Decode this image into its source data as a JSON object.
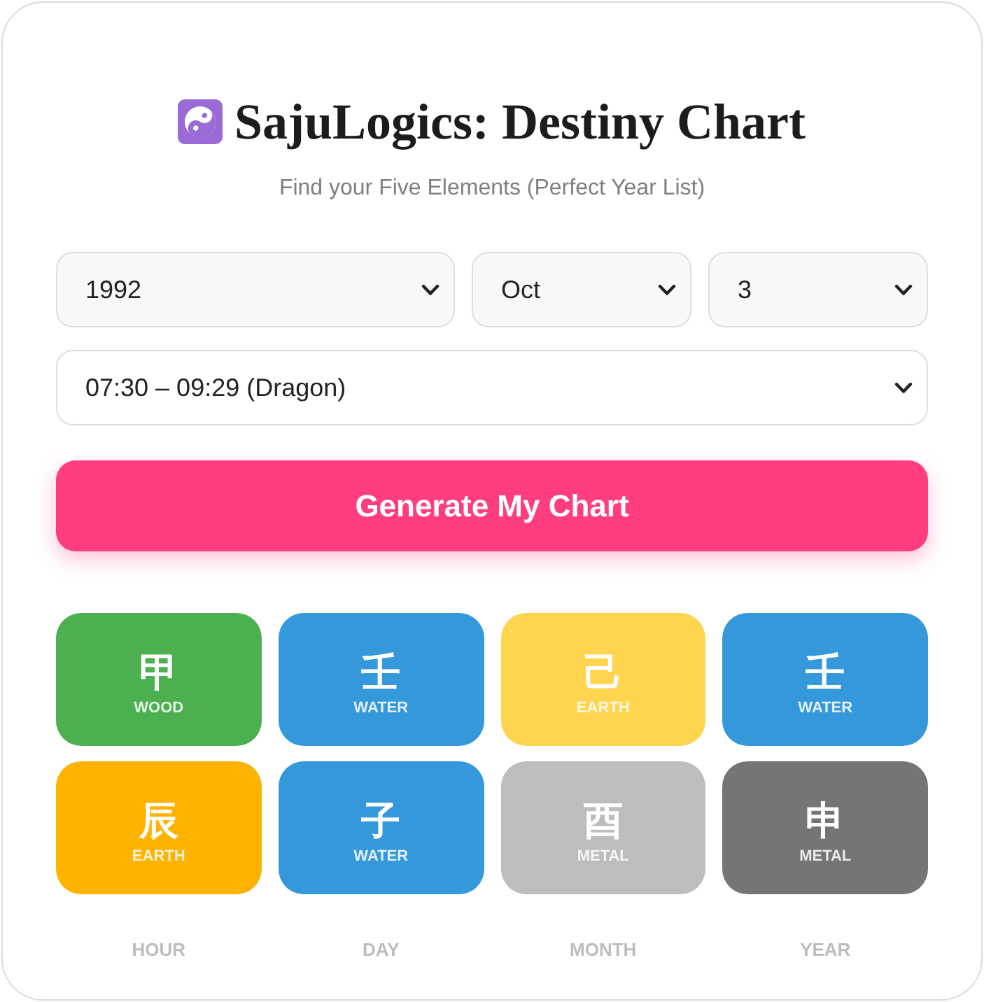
{
  "header": {
    "title": "SajuLogics: Destiny Chart",
    "subtitle": "Find your Five Elements (Perfect Year List)"
  },
  "date_fields": [
    {
      "kind": "year",
      "value": "1992"
    },
    {
      "kind": "month",
      "value": "Oct"
    },
    {
      "kind": "day",
      "value": "3"
    }
  ],
  "time_field": {
    "value": "07:30 – 09:29 (Dragon)"
  },
  "button": "Generate My Chart",
  "pillars": [
    {
      "label": "HOUR",
      "stem": {
        "char": "甲",
        "element": "WOOD",
        "color": "#4caf50"
      },
      "branch": {
        "char": "辰",
        "element": "EARTH",
        "color": "#ffb300"
      }
    },
    {
      "label": "DAY",
      "stem": {
        "char": "壬",
        "element": "WATER",
        "color": "#3498db"
      },
      "branch": {
        "char": "子",
        "element": "WATER",
        "color": "#3498db"
      }
    },
    {
      "label": "MONTH",
      "stem": {
        "char": "己",
        "element": "EARTH",
        "color": "#ffd54f"
      },
      "branch": {
        "char": "酉",
        "element": "METAL",
        "color": "#bdbdbd"
      }
    },
    {
      "label": "YEAR",
      "stem": {
        "char": "壬",
        "element": "WATER",
        "color": "#3498db"
      },
      "branch": {
        "char": "申",
        "element": "METAL",
        "color": "#757575"
      }
    }
  ]
}
